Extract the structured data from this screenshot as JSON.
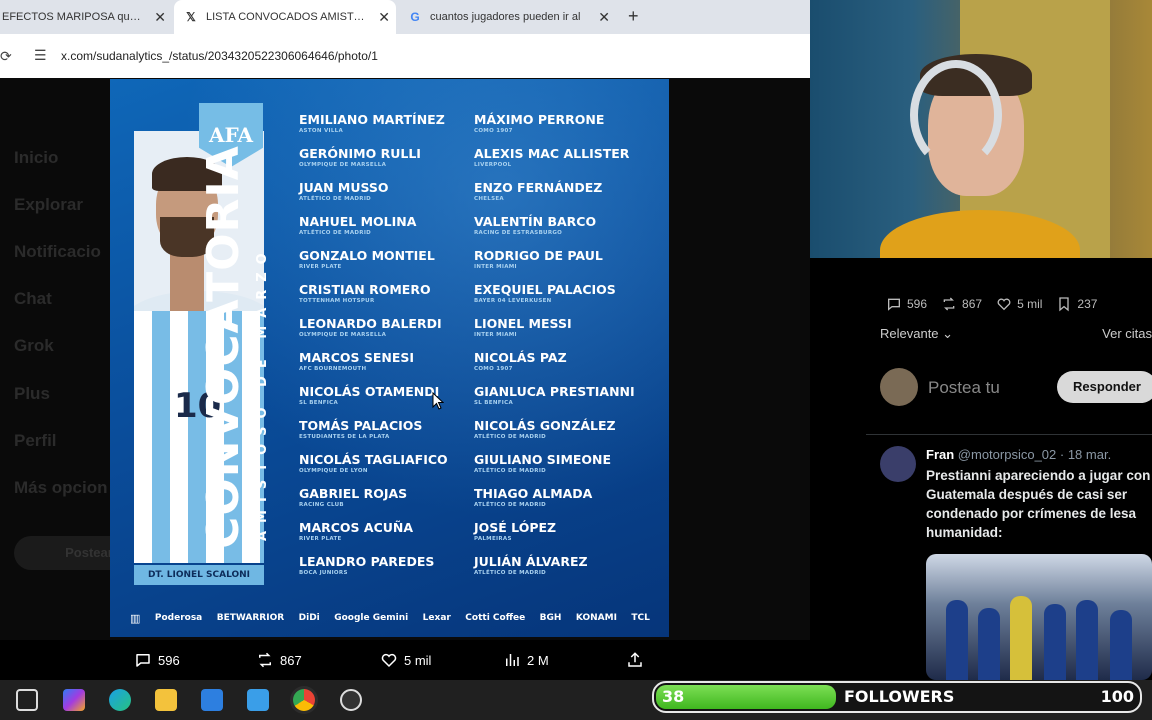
{
  "browser": {
    "tabs": [
      {
        "label": "EFECTOS MARIPOSA que al",
        "icon": "tab-icon"
      },
      {
        "label": "LISTA CONVOCADOS AMISTOS",
        "icon": "x-logo-icon"
      },
      {
        "label": "cuantos jugadores pueden ir al",
        "icon": "google-icon"
      }
    ],
    "url": "x.com/sudanalytics_/status/2034320522306064646/photo/1"
  },
  "sidebar": [
    "Inicio",
    "Explorar",
    "Notificacio",
    "Chat",
    "Grok",
    "Plus",
    "Perfil",
    "Más opcion"
  ],
  "sidebar_post": "Postear",
  "poster": {
    "crest": "AFA",
    "title": "CONVOCATORIA",
    "subtitle": "AMISTOSO DE MARZO",
    "coach": "DT. LIONEL SCALONI",
    "shirt_number": "10",
    "players_left": [
      {
        "name": "EMILIANO MARTÍNEZ",
        "club": "ASTON VILLA"
      },
      {
        "name": "GERÓNIMO RULLI",
        "club": "OLYMPIQUE DE MARSELLA"
      },
      {
        "name": "JUAN MUSSO",
        "club": "ATLÉTICO DE MADRID"
      },
      {
        "name": "NAHUEL MOLINA",
        "club": "ATLÉTICO DE MADRID"
      },
      {
        "name": "GONZALO MONTIEL",
        "club": "RIVER PLATE"
      },
      {
        "name": "CRISTIAN ROMERO",
        "club": "TOTTENHAM HOTSPUR"
      },
      {
        "name": "LEONARDO BALERDI",
        "club": "OLYMPIQUE DE MARSELLA"
      },
      {
        "name": "MARCOS SENESI",
        "club": "AFC BOURNEMOUTH"
      },
      {
        "name": "NICOLÁS OTAMENDI",
        "club": "SL BENFICA"
      },
      {
        "name": "TOMÁS PALACIOS",
        "club": "ESTUDIANTES DE LA PLATA"
      },
      {
        "name": "NICOLÁS TAGLIAFICO",
        "club": "OLYMPIQUE DE LYON"
      },
      {
        "name": "GABRIEL ROJAS",
        "club": "RACING CLUB"
      },
      {
        "name": "MARCOS ACUÑA",
        "club": "RIVER PLATE"
      },
      {
        "name": "LEANDRO PAREDES",
        "club": "BOCA JUNIORS"
      }
    ],
    "players_right": [
      {
        "name": "MÁXIMO PERRONE",
        "club": "COMO 1907"
      },
      {
        "name": "ALEXIS MAC ALLISTER",
        "club": "LIVERPOOL"
      },
      {
        "name": "ENZO FERNÁNDEZ",
        "club": "CHELSEA"
      },
      {
        "name": "VALENTÍN BARCO",
        "club": "RACING DE ESTRASBURGO"
      },
      {
        "name": "RODRIGO DE PAUL",
        "club": "INTER MIAMI"
      },
      {
        "name": "EXEQUIEL PALACIOS",
        "club": "BAYER 04 LEVERKUSEN"
      },
      {
        "name": "LIONEL MESSI",
        "club": "INTER MIAMI"
      },
      {
        "name": "NICOLÁS PAZ",
        "club": "COMO 1907"
      },
      {
        "name": "GIANLUCA PRESTIANNI",
        "club": "SL BENFICA"
      },
      {
        "name": "NICOLÁS GONZÁLEZ",
        "club": "ATLÉTICO DE MADRID"
      },
      {
        "name": "GIULIANO SIMEONE",
        "club": "ATLÉTICO DE MADRID"
      },
      {
        "name": "THIAGO ALMADA",
        "club": "ATLÉTICO DE MADRID"
      },
      {
        "name": "JOSÉ LÓPEZ",
        "club": "PALMEIRAS"
      },
      {
        "name": "JULIÁN ÁLVAREZ",
        "club": "ATLÉTICO DE MADRID"
      }
    ],
    "sponsors": [
      "Poderosa",
      "BETWARRIOR",
      "DiDi",
      "Google Gemini",
      "Lexar",
      "Cotti Coffee",
      "BGH",
      "KONAMI",
      "TCL"
    ]
  },
  "post_actions": {
    "replies": "596",
    "reposts": "867",
    "likes": "5 mil",
    "views": "2 M"
  },
  "right_panel": {
    "stats": {
      "replies": "596",
      "reposts": "867",
      "likes": "5 mil",
      "bookmarks": "237"
    },
    "sort_label": "Relevante",
    "quotes_link": "Ver citas",
    "compose_placeholder": "Postea tu",
    "reply_button": "Responder",
    "reply": {
      "name": "Fran",
      "handle": "@motorpsico_02",
      "date": "· 18 mar.",
      "text": "Prestianni apareciendo a jugar con Guatemala después de casi ser condenado por crímenes de lesa humanidad:"
    }
  },
  "followers_widget": {
    "title": "FOLLOWERS",
    "current": "38",
    "goal": "100",
    "progress": 0.38
  },
  "colors": {
    "poster_blue": "#0a4e9c",
    "afa_light_blue": "#76bde6",
    "progress_green": "#3fb71f",
    "reply_button": "#d9d9d9"
  }
}
